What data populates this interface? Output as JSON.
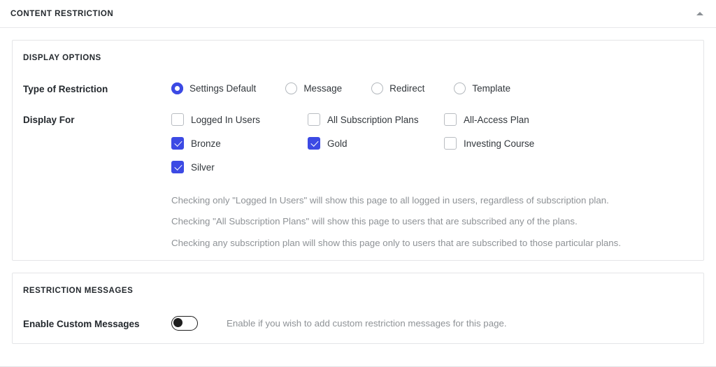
{
  "panel": {
    "title": "CONTENT RESTRICTION",
    "collapse_icon": "caret-up-icon",
    "accent_color": "#3c4ae4",
    "muted_text_color": "#8e9296"
  },
  "display_options": {
    "section_label": "DISPLAY OPTIONS",
    "type_of_restriction": {
      "label": "Type of Restriction",
      "options": [
        {
          "label": "Settings Default",
          "checked": true
        },
        {
          "label": "Message",
          "checked": false
        },
        {
          "label": "Redirect",
          "checked": false
        },
        {
          "label": "Template",
          "checked": false
        }
      ]
    },
    "display_for": {
      "label": "Display For",
      "rows": [
        [
          {
            "label": "Logged In Users",
            "checked": false
          },
          {
            "label": "All Subscription Plans",
            "checked": false
          },
          {
            "label": "All-Access Plan",
            "checked": false
          }
        ],
        [
          {
            "label": "Bronze",
            "checked": true
          },
          {
            "label": "Gold",
            "checked": true
          },
          {
            "label": "Investing Course",
            "checked": false
          }
        ],
        [
          {
            "label": "Silver",
            "checked": true
          },
          {
            "label": "",
            "checked": false
          },
          {
            "label": "",
            "checked": false
          }
        ]
      ],
      "help_lines": [
        "Checking only \"Logged In Users\" will show this page to all logged in users, regardless of subscription plan.",
        "Checking \"All Subscription Plans\" will show this page to users that are subscribed any of the plans.",
        "Checking any subscription plan will show this page only to users that are subscribed to those particular plans."
      ]
    }
  },
  "restriction_messages": {
    "section_label": "RESTRICTION MESSAGES",
    "enable_custom_messages": {
      "label": "Enable Custom Messages",
      "enabled": false,
      "help": "Enable if you wish to add custom restriction messages for this page."
    }
  }
}
